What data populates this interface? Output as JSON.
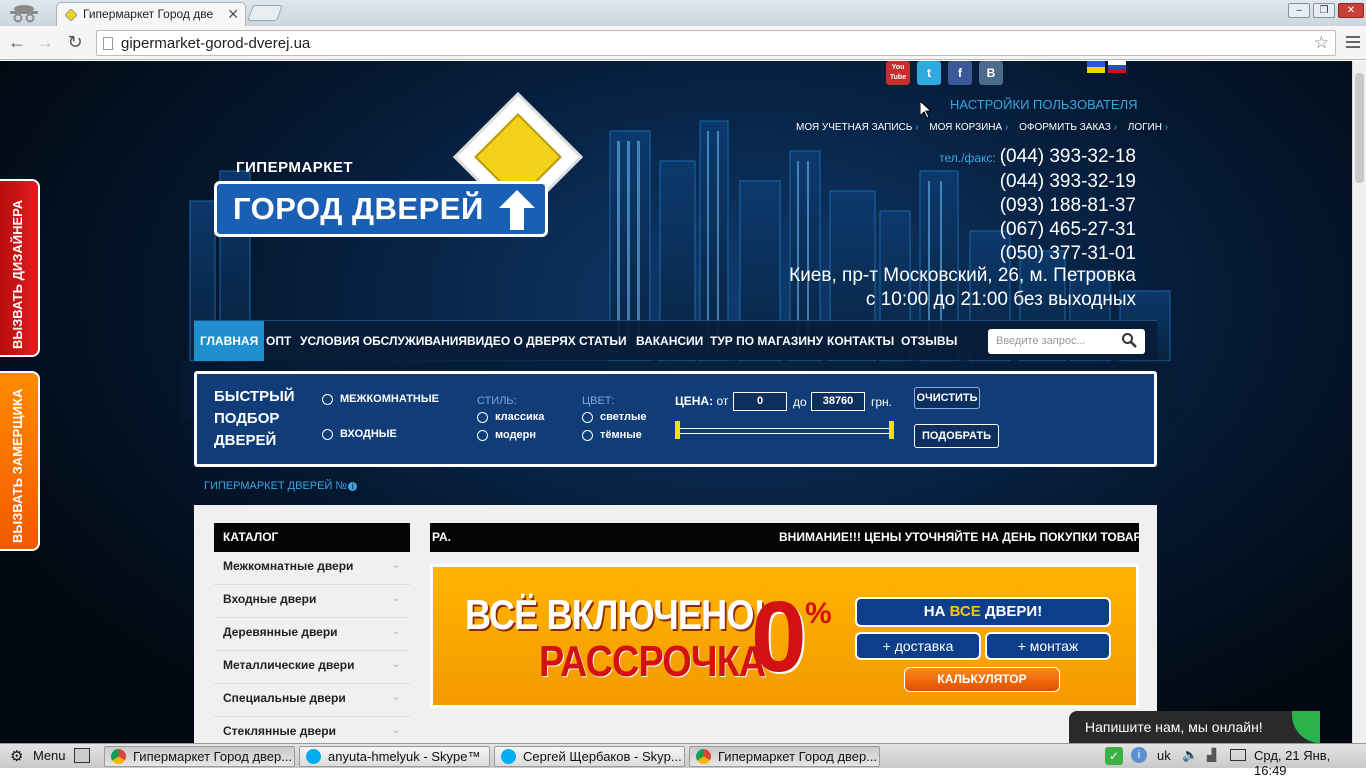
{
  "browser": {
    "tab_title": "Гипермаркет Город две",
    "url": "gipermarket-gorod-dverej.ua"
  },
  "header": {
    "social": [
      "youtube-icon",
      "twitter-icon",
      "facebook-icon",
      "vkontakte-icon"
    ],
    "youtube_text": "You Tube",
    "vk_text": "B",
    "settings_link": "НАСТРОЙКИ ПОЛЬЗОВАТЕЛЯ",
    "account_links": [
      "МОЯ УЧЕТНАЯ ЗАПИСЬ",
      "МОЯ КОРЗИНА",
      "ОФОРМИТЬ ЗАКАЗ",
      "ЛОГИН"
    ],
    "phone_label": "тел./факс:",
    "phones": [
      "(044) 393-32-18",
      "(044) 393-32-19",
      "(093) 188-81-37",
      "(067) 465-27-31",
      "(050) 377-31-01"
    ],
    "address": "Киев, пр-т Московский, 26, м. Петровка",
    "hours": "с 10:00 до 21:00 без выходных"
  },
  "logo": {
    "top": "ГИПЕРМАРКЕТ",
    "main": "ГОРОД ДВЕРЕЙ"
  },
  "nav": {
    "items": [
      "ГЛАВНАЯ",
      "ОПТ",
      "УСЛОВИЯ ОБСЛУЖИВАНИЯ",
      "ВИДЕО О ДВЕРЯХ",
      "СТАТЬИ",
      "ВАКАНСИИ",
      "ТУР ПО МАГАЗИНУ",
      "КОНТАКТЫ",
      "ОТЗЫВЫ"
    ],
    "search_placeholder": "Введите запрос..."
  },
  "quick_filter": {
    "title_lines": [
      "БЫСТРЫЙ",
      "ПОДБОР",
      "ДВЕРЕЙ"
    ],
    "types": [
      "МЕЖКОМНАТНЫЕ",
      "ВХОДНЫЕ"
    ],
    "style_label": "СТИЛЬ:",
    "styles": [
      "классика",
      "модерн"
    ],
    "color_label": "ЦВЕТ:",
    "colors": [
      "светлые",
      "тёмные"
    ],
    "price_label": "ЦЕНА:",
    "from_label": "от",
    "from_value": "0",
    "to_label": "до",
    "to_value": "38760",
    "currency": "грн.",
    "clear_button": "ОЧИСТИТЬ",
    "submit_button": "ПОДОБРАТЬ"
  },
  "breadcrumb": "ГИПЕРМАРКЕТ ДВЕРЕЙ №",
  "catalog": {
    "title": "КАТАЛОГ",
    "items": [
      "Межкомнатные двери",
      "Входные двери",
      "Деревянные двери",
      "Металлические двери",
      "Специальные двери",
      "Стеклянные двери"
    ]
  },
  "ticker": {
    "left_fragment": "РА.",
    "text": "ВНИМАНИЕ!!! ЦЕНЫ УТОЧНЯЙТЕ НА ДЕНЬ ПОКУПКИ ТОВАР"
  },
  "banner": {
    "line1": "ВСЁ ВКЛЮЧЕНО!",
    "line2": "РАССРОЧКА",
    "zero": "0",
    "percent": "%",
    "doors_pre": "НА ",
    "doors_hl": "ВСЕ",
    "doors_post": " ДВЕРИ!",
    "delivery": "+ доставка",
    "install": "+ монтаж",
    "calculator": "КАЛЬКУЛЯТОР"
  },
  "side_tabs": {
    "designer": "ВЫЗВАТЬ ДИЗАЙНЕРА",
    "measurer": "ВЫЗВАТЬ ЗАМЕРЩИКА"
  },
  "chat": "Напишите нам, мы онлайн!",
  "taskbar": {
    "menu": "Menu",
    "tasks": [
      "Гипермаркет Город двер...",
      "anyuta-hmelyuk - Skype™",
      "Сергей Щербаков - Skyp...",
      "Гипермаркет Город двер..."
    ],
    "lang": "uk",
    "clock": "Срд, 21 Янв, 16:49"
  },
  "colors": {
    "accent": "#3aa6e0",
    "nav_active": "#1f8fd0",
    "filter_bg": "#103c78",
    "banner": "#f49a00",
    "sale_red": "#d21212"
  }
}
